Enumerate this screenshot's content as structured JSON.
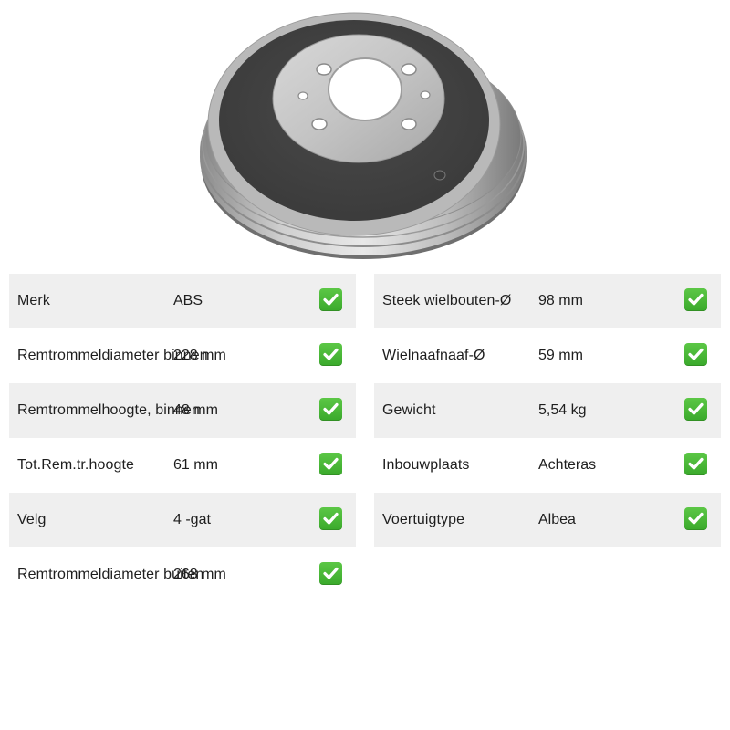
{
  "product": {
    "image_icon": "brake-drum"
  },
  "colors": {
    "row_shade": "#efefef",
    "check_green": "#4cba38"
  },
  "specs_left": [
    {
      "label": "Merk",
      "value": "ABS",
      "icon": "check-icon"
    },
    {
      "label": "Remtrommeldiameter binnen",
      "value": "228 mm",
      "icon": "check-icon"
    },
    {
      "label": "Remtrommelhoogte, binnen",
      "value": "48 mm",
      "icon": "check-icon"
    },
    {
      "label": "Tot.Rem.tr.hoogte",
      "value": "61 mm",
      "icon": "check-icon"
    },
    {
      "label": "Velg",
      "value": "4 -gat",
      "icon": "check-icon"
    },
    {
      "label": "Remtrommeldiameter buiten",
      "value": "268 mm",
      "icon": "check-icon"
    }
  ],
  "specs_right": [
    {
      "label": "Steek wielbouten-Ø",
      "value": "98 mm",
      "icon": "check-icon"
    },
    {
      "label": "Wielnaafnaaf-Ø",
      "value": "59 mm",
      "icon": "check-icon"
    },
    {
      "label": "Gewicht",
      "value": "5,54 kg",
      "icon": "check-icon"
    },
    {
      "label": "Inbouwplaats",
      "value": "Achteras",
      "icon": "check-icon"
    },
    {
      "label": "Voertuigtype",
      "value": "Albea",
      "icon": "check-icon"
    }
  ]
}
